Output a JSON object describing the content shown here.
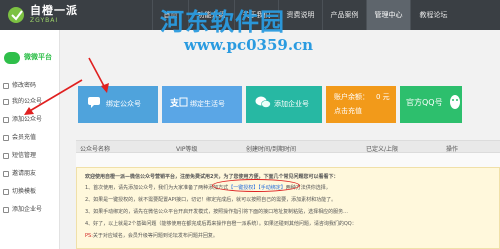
{
  "logo": {
    "text": "自橙一派",
    "sub": "ZGYBAI"
  },
  "nav": {
    "items": [
      "首页",
      "功能介绍",
      "关于我们",
      "资费说明",
      "产品案例",
      "管理中心",
      "教程论坛"
    ],
    "active_index": 5
  },
  "watermark": {
    "title": "河东软件园",
    "url": "www.pc0359.cn"
  },
  "sidebar": {
    "brand": "微微平台",
    "items": [
      "修改密码",
      "我的公众号",
      "添加公众号",
      "会员充值",
      "短信管理",
      "邀请朋友",
      "切换模板",
      "添加企业号"
    ]
  },
  "cards": [
    {
      "label": "绑定公众号",
      "icon": "chat-bubble-icon",
      "color": "#4fa3dc"
    },
    {
      "label": "绑定生活号",
      "icon": "alipay-logo-icon",
      "color": "#5aa6e6"
    },
    {
      "label": "添加企业号",
      "icon": "wechat-logo-icon",
      "color": "#27b8a3"
    },
    {
      "label": "账户余额：",
      "value": "0 元",
      "action": "点击充值",
      "color": "#f29a1a"
    },
    {
      "label": "官方QQ号",
      "icon": "qq-penguin-icon",
      "color": "#2dbf6d"
    }
  ],
  "table": {
    "columns": [
      "公众号名称",
      "VIP等级",
      "创建时间/到期时间",
      "已定义/上限",
      "操作"
    ]
  },
  "notice": {
    "title": "欢迎使用自橙一派—微信公众号营销平台，注册免费试用2天，为了您使用方便，下面几个常见问题您可以看看下：",
    "line1_prefix": "1、首次使用，请先添加公众号，我们为大家准备了两种添加方式",
    "line1_highlight": "【一键授权】【手动绑定】",
    "line1_suffix": "两种方法供你选择，",
    "line2": "2、如果是一键授权的，就不需要配置API接口，切记！绑定完成后，就可以按照自己的需要，添加素材和功能了。",
    "line3": "3、如果手动绑定的，请先在微信公众平台开启开发模式，按照操作指引将下面的接口地址复制粘贴，选择相应的服务...",
    "line4": "4、好了，以上就是2个基础问题（能够使用在都完成后再来操作自橙一派系统）。如果还碰到其他问题，请咨询我们的QQ：",
    "line5_label": "PS:",
    "line5": "关于对应域名，会员升级等问题到论坛发布问题并回复。"
  }
}
